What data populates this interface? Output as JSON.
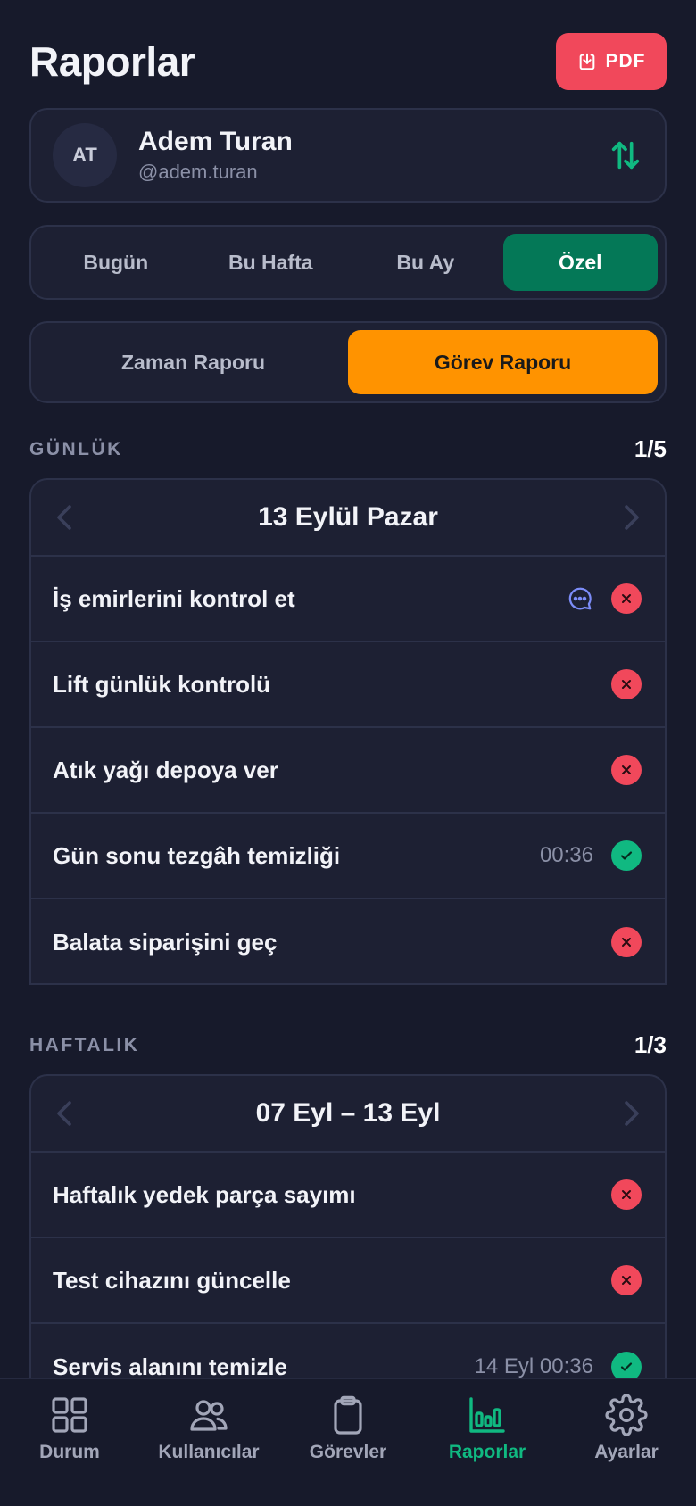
{
  "header": {
    "title": "Raporlar",
    "pdf_label": "PDF"
  },
  "user": {
    "initials": "AT",
    "name": "Adem Turan",
    "handle": "@adem.turan"
  },
  "period_tabs": [
    {
      "label": "Bugün",
      "active": false
    },
    {
      "label": "Bu Hafta",
      "active": false
    },
    {
      "label": "Bu Ay",
      "active": false
    },
    {
      "label": "Özel",
      "active": true
    }
  ],
  "report_tabs": [
    {
      "label": "Zaman Raporu",
      "active": false
    },
    {
      "label": "Görev Raporu",
      "active": true
    }
  ],
  "daily": {
    "label": "GÜNLÜK",
    "count": "1/5",
    "date": "13 Eylül Pazar",
    "tasks": [
      {
        "title": "İş emirlerini kontrol et",
        "time": "",
        "comment": true,
        "status": "fail"
      },
      {
        "title": "Lift günlük kontrolü",
        "time": "",
        "comment": false,
        "status": "fail"
      },
      {
        "title": "Atık yağı depoya ver",
        "time": "",
        "comment": false,
        "status": "fail"
      },
      {
        "title": "Gün sonu tezgâh temizliği",
        "time": "00:36",
        "comment": false,
        "status": "done"
      },
      {
        "title": "Balata siparişini geç",
        "time": "",
        "comment": false,
        "status": "fail"
      }
    ]
  },
  "weekly": {
    "label": "HAFTALIK",
    "count": "1/3",
    "date": "07 Eyl – 13 Eyl",
    "tasks": [
      {
        "title": "Haftalık yedek parça sayımı",
        "time": "",
        "comment": false,
        "status": "fail"
      },
      {
        "title": "Test cihazını güncelle",
        "time": "",
        "comment": false,
        "status": "fail"
      },
      {
        "title": "Servis alanını temizle",
        "time": "14 Eyl 00:36",
        "comment": false,
        "status": "done"
      }
    ]
  },
  "tabbar": [
    {
      "label": "Durum",
      "icon": "grid-icon",
      "active": false
    },
    {
      "label": "Kullanıcılar",
      "icon": "users-icon",
      "active": false
    },
    {
      "label": "Görevler",
      "icon": "clipboard-icon",
      "active": false
    },
    {
      "label": "Raporlar",
      "icon": "bar-chart-icon",
      "active": true
    },
    {
      "label": "Ayarlar",
      "icon": "gear-icon",
      "active": false
    }
  ],
  "colors": {
    "background": "#171a2b",
    "card": "#1d2033",
    "accent_green": "#047857",
    "accent_orange": "#ff9300",
    "danger": "#f1485b",
    "success": "#10b981"
  }
}
